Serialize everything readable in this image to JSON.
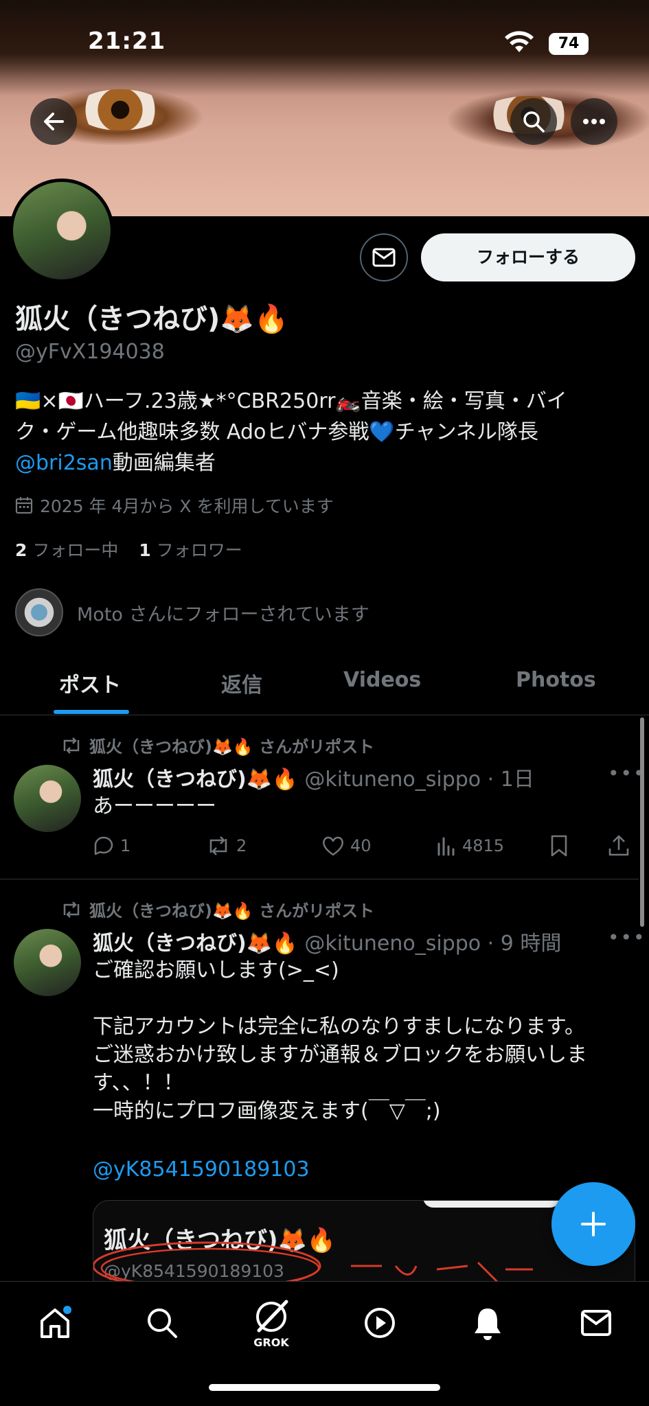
{
  "status_bar": {
    "time": "21:21",
    "battery": "74"
  },
  "profile": {
    "display_name": "狐火（きつねび)🦊🔥",
    "handle": "@yFvX194038",
    "follow_label": "フォローする",
    "bio_line1": "🇺🇦×🇯🇵ハーフ.23歳★*°CBR250rr🏍️音楽・絵・写真・バイ",
    "bio_line2": "ク・ゲーム他趣味多数 Adoヒバナ参戦💙チャンネル隊長",
    "bio_link": "@bri2san",
    "bio_line3_rest": "動画編集者",
    "joined": "2025 年 4月から X を利用しています",
    "following_count": "2",
    "following_label": "フォロー中",
    "followers_count": "1",
    "followers_label": "フォロワー",
    "followed_by": "Moto さんにフォローされています"
  },
  "tabs": [
    {
      "label": "ポスト",
      "active": true
    },
    {
      "label": "返信",
      "active": false
    },
    {
      "label": "Videos",
      "active": false
    },
    {
      "label": "Photos",
      "active": false
    }
  ],
  "posts": [
    {
      "repost_by": "狐火（きつねび)🦊🔥 さんがリポスト",
      "author": "狐火（きつねび)🦊🔥",
      "handle_time": "@kituneno_sippo · 1日",
      "text": "あーーーーー",
      "replies": "1",
      "reposts": "2",
      "likes": "40",
      "views": "4815"
    },
    {
      "repost_by": "狐火（きつねび)🦊🔥 さんがリポスト",
      "author": "狐火（きつねび)🦊🔥",
      "handle_time": "@kituneno_sippo · 9 時間",
      "text": "ご確認お願いします(>_<)\n\n下記アカウントは完全に私のなりすましになります。\nご迷惑おかけ致しますが通報＆ブロックをお願いしま\nす、、！！\n一時的にプロフ画像変えます(￣▽￣;)",
      "mention": "@yK8541590189103",
      "embed_name": "狐火（きつねび)🦊🔥",
      "embed_handle": "@yK8541590189103"
    }
  ],
  "bottom_nav": {
    "grok_label": "GROK"
  },
  "colors": {
    "accent": "#1d9bf0",
    "background": "#000000",
    "muted": "#71767b"
  }
}
